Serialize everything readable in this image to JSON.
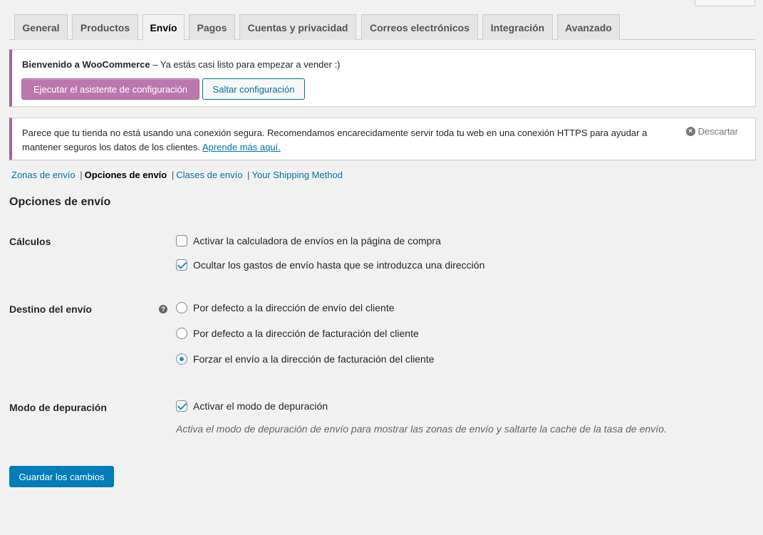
{
  "tabs": [
    {
      "label": "General"
    },
    {
      "label": "Productos"
    },
    {
      "label": "Envío",
      "active": true
    },
    {
      "label": "Pagos"
    },
    {
      "label": "Cuentas y privacidad"
    },
    {
      "label": "Correos electrónicos"
    },
    {
      "label": "Integración"
    },
    {
      "label": "Avanzado"
    }
  ],
  "welcome_notice": {
    "title": "Bienvenido a WooCommerce",
    "message": " – Ya estás casi listo para empezar a vender :)",
    "setup_button": "Ejecutar el asistente de configuración",
    "skip_button": "Saltar configuración"
  },
  "ssl_notice": {
    "text": "Parece que tu tienda no está usando una conexión segura. Recomendamos encarecidamente servir toda tu web en una conexión HTTPS para ayudar a mantener seguros los datos de los clientes. ",
    "link": "Aprende más aquí.",
    "dismiss": "Descartar"
  },
  "subnav": {
    "zones": "Zonas de envío",
    "options": "Opciones de envío",
    "classes": "Clases de envío",
    "custom": "Your Shipping Method",
    "separator": "|"
  },
  "section_title": "Opciones de envío",
  "calculations": {
    "label": "Cálculos",
    "option1": "Activar la calculadora de envíos en la página de compra",
    "option1_checked": false,
    "option2": "Ocultar los gastos de envío hasta que se introduzca una dirección",
    "option2_checked": true
  },
  "destination": {
    "label": "Destino del envío",
    "help": "?",
    "options": [
      "Por defecto a la dirección de envío del cliente",
      "Por defecto a la dirección de facturación del cliente",
      "Forzar el envío a la dirección de facturación del cliente"
    ],
    "selected_index": 2
  },
  "debug": {
    "label": "Modo de depuración",
    "option": "Activar el modo de depuración",
    "checked": true,
    "description": "Activa el modo de depuración de envío para mostrar las zonas de envío y saltarte la cache de la tasa de envío."
  },
  "save_button": "Guardar los cambios",
  "colors": {
    "accent": "#0073aa",
    "woo_purple": "#bb77ae",
    "save_blue": "#007cba"
  }
}
